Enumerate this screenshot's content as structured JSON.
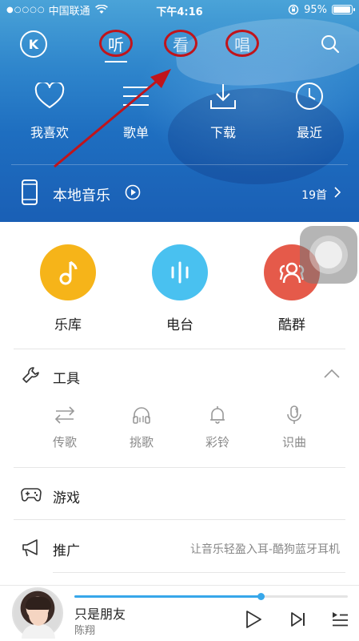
{
  "status_bar": {
    "signal_dots": "●○○○○",
    "carrier": "中国联通",
    "time": "下午4:16",
    "battery_text": "95%",
    "battery_level": 0.95
  },
  "nav": {
    "logo": "K",
    "tabs": [
      {
        "label": "听",
        "active": true
      },
      {
        "label": "看",
        "active": false
      },
      {
        "label": "唱",
        "active": false
      }
    ],
    "search_icon": "search-icon"
  },
  "quick_entries": [
    {
      "label": "我喜欢",
      "icon": "heart-icon"
    },
    {
      "label": "歌单",
      "icon": "list-icon"
    },
    {
      "label": "下载",
      "icon": "download-icon"
    },
    {
      "label": "最近",
      "icon": "clock-icon"
    }
  ],
  "local_music": {
    "label": "本地音乐",
    "count": "19首"
  },
  "features": [
    {
      "label": "乐库",
      "color": "#f6b419",
      "icon": "music-note-icon"
    },
    {
      "label": "电台",
      "color": "#49c1f0",
      "icon": "sound-wave-icon"
    },
    {
      "label": "酷群",
      "color": "#e55a4a",
      "icon": "group-icon"
    }
  ],
  "tools": {
    "title": "工具",
    "items": [
      {
        "label": "传歌",
        "icon": "transfer-icon"
      },
      {
        "label": "挑歌",
        "icon": "headphones-icon"
      },
      {
        "label": "彩铃",
        "icon": "bell-icon"
      },
      {
        "label": "识曲",
        "icon": "mic-icon"
      }
    ]
  },
  "rows": {
    "game": {
      "title": "游戏"
    },
    "promo": {
      "title": "推广",
      "subtitle": "让音乐轻盈入耳-酷狗蓝牙耳机"
    }
  },
  "player": {
    "song": "只是朋友",
    "artist": "陈翔",
    "progress": 0.68
  },
  "colors": {
    "accent_blue": "#37a7ea",
    "annotation_red": "#c0141b"
  }
}
